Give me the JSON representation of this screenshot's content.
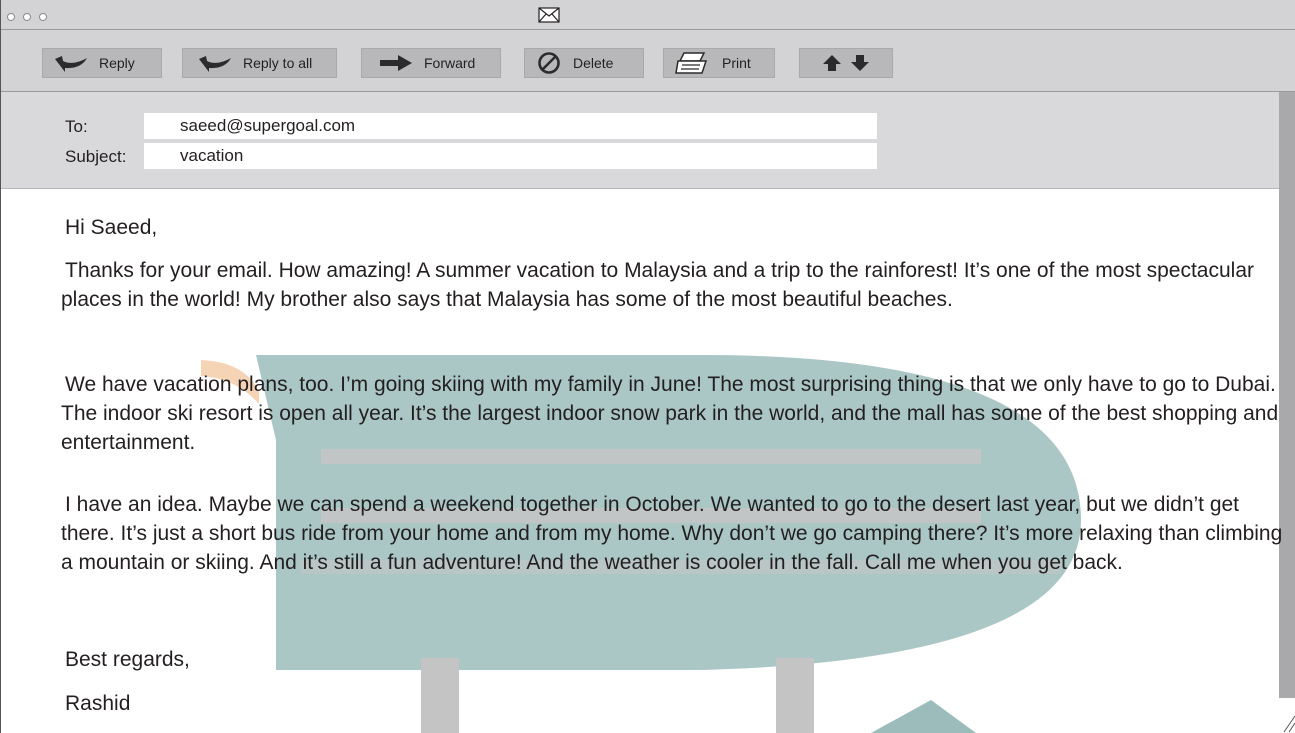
{
  "window": {
    "title_icon": "envelope-icon"
  },
  "toolbar": {
    "reply_label": "Reply",
    "reply_all_label": "Reply to all",
    "forward_label": "Forward",
    "delete_label": "Delete",
    "print_label": "Print"
  },
  "header": {
    "to_label": "To:",
    "to_value": "saeed@supergoal.com",
    "subject_label": "Subject:",
    "subject_value": "vacation"
  },
  "message": {
    "greeting": "Hi Saeed,",
    "paragraph_1": "Thanks for your email. How amazing! A summer vacation to Malaysia and a trip to the rainforest! It’s one of the most spectacular places in the world! My brother also says that Malaysia has some of the most beautiful beaches.",
    "paragraph_2": "We have vacation plans, too. I’m going skiing with my family in June! The most surprising thing is that we only have to go to Dubai. The indoor ski resort is open all year. It’s the largest indoor snow park in the world, and the mall has some of the best shopping and entertainment.",
    "paragraph_3": "I have an idea. Maybe we can spend a weekend together in October. We wanted to go to the desert last year, but we didn’t get there. It’s just a short bus ride from your home and from my home. Why don’t we go camping there? It’s more relaxing than climbing a mountain or skiing. And it’s still a fun adventure! And the weather is cooler in the fall. Call me when you get back.",
    "closing": "Best regards,",
    "signature": "Rashid"
  },
  "colors": {
    "chrome": "#d3d3d6",
    "button": "#b8b8bb",
    "watermark_teal": "#9bbcbb",
    "watermark_gray": "#c4c4c4",
    "watermark_orange": "#f3c9a4"
  }
}
